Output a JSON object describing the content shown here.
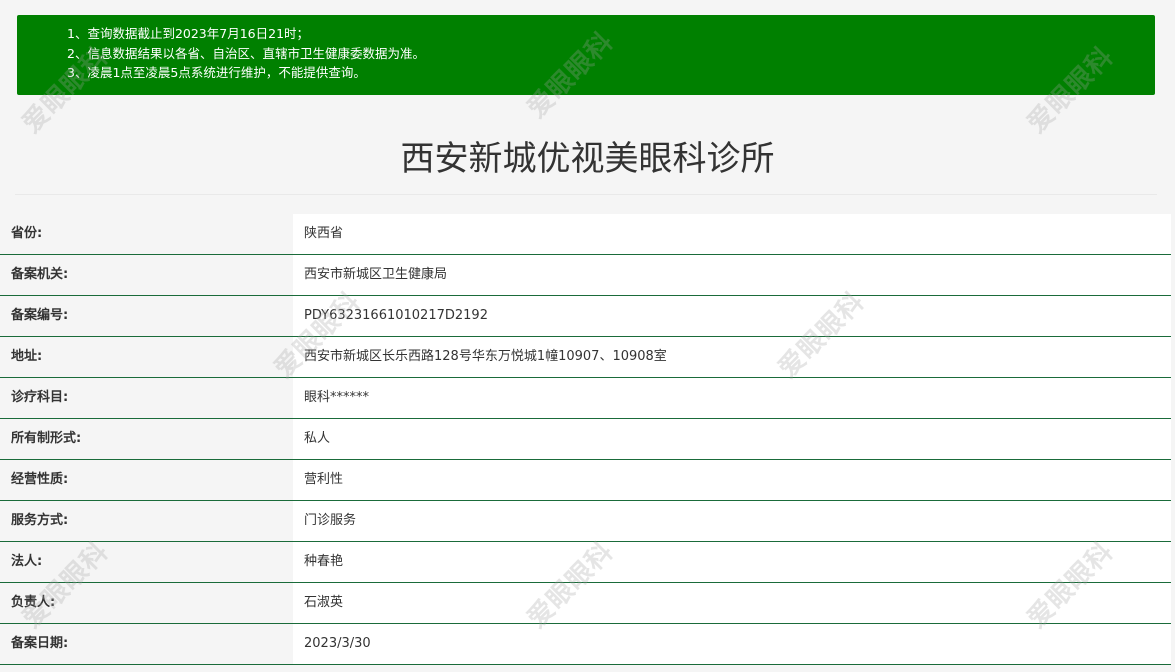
{
  "notice": {
    "lines": [
      "1、查询数据截止到2023年7月16日21时；",
      "2、信息数据结果以各省、自治区、直辖市卫生健康委数据为准。",
      "3、凌晨1点至凌晨5点系统进行维护，不能提供查询。"
    ]
  },
  "page_title": "西安新城优视美眼科诊所",
  "info_rows": [
    {
      "label": "省份:",
      "value": "陕西省"
    },
    {
      "label": "备案机关:",
      "value": "西安市新城区卫生健康局"
    },
    {
      "label": "备案编号:",
      "value": "PDY63231661010217D2192"
    },
    {
      "label": "地址:",
      "value": "西安市新城区长乐西路128号华东万悦城1幢10907、10908室"
    },
    {
      "label": "诊疗科目:",
      "value": "眼科******"
    },
    {
      "label": "所有制形式:",
      "value": "私人"
    },
    {
      "label": "经营性质:",
      "value": "营利性"
    },
    {
      "label": "服务方式:",
      "value": "门诊服务"
    },
    {
      "label": "法人:",
      "value": "种春艳"
    },
    {
      "label": "负责人:",
      "value": "石淑英"
    },
    {
      "label": "备案日期:",
      "value": "2023/3/30"
    }
  ],
  "watermark": {
    "text": "爱眼眼科"
  },
  "colors": {
    "notice_bg": "#008000",
    "row_divider": "#1a6b3a",
    "page_bg": "#f5f5f5"
  }
}
